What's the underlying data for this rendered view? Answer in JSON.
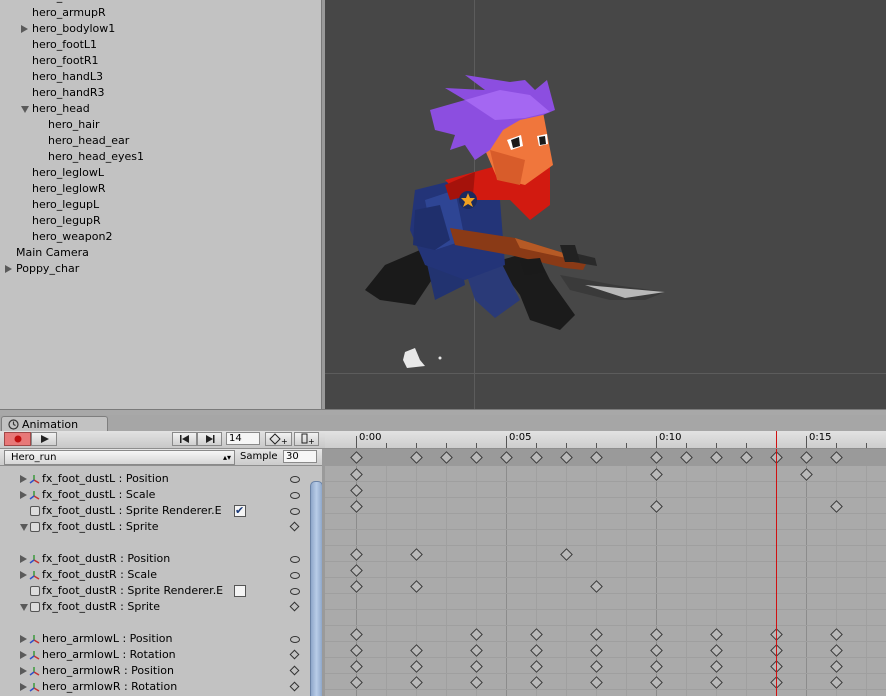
{
  "hierarchy": {
    "items": [
      {
        "label": "hero_armlowR",
        "indent": 32,
        "arrow": "",
        "partial": true
      },
      {
        "label": "hero_armupR",
        "indent": 32,
        "arrow": ""
      },
      {
        "label": "hero_bodylow1",
        "indent": 32,
        "arrow": "right"
      },
      {
        "label": "hero_footL1",
        "indent": 32,
        "arrow": ""
      },
      {
        "label": "hero_footR1",
        "indent": 32,
        "arrow": ""
      },
      {
        "label": "hero_handL3",
        "indent": 32,
        "arrow": ""
      },
      {
        "label": "hero_handR3",
        "indent": 32,
        "arrow": ""
      },
      {
        "label": "hero_head",
        "indent": 32,
        "arrow": "down"
      },
      {
        "label": "hero_hair",
        "indent": 48,
        "arrow": ""
      },
      {
        "label": "hero_head_ear",
        "indent": 48,
        "arrow": ""
      },
      {
        "label": "hero_head_eyes1",
        "indent": 48,
        "arrow": ""
      },
      {
        "label": "hero_leglowL",
        "indent": 32,
        "arrow": ""
      },
      {
        "label": "hero_leglowR",
        "indent": 32,
        "arrow": ""
      },
      {
        "label": "hero_legupL",
        "indent": 32,
        "arrow": ""
      },
      {
        "label": "hero_legupR",
        "indent": 32,
        "arrow": ""
      },
      {
        "label": "hero_weapon2",
        "indent": 32,
        "arrow": ""
      },
      {
        "label": "Main Camera",
        "indent": 16,
        "arrow": ""
      },
      {
        "label": "Poppy_char",
        "indent": 16,
        "arrow": "right"
      }
    ]
  },
  "animation": {
    "tab_label": "Animation",
    "frame_value": "14",
    "clip_name": "Hero_run",
    "sample_label": "Sample",
    "sample_value": "30",
    "time_labels": [
      "0:00",
      "0:05",
      "0:10",
      "0:15"
    ],
    "properties": [
      {
        "label": "fx_foot_dustL : Position",
        "icon": "transform",
        "arrow": "right",
        "state": "eye"
      },
      {
        "label": "fx_foot_dustL : Scale",
        "icon": "transform",
        "arrow": "right",
        "state": "eye"
      },
      {
        "label": "fx_foot_dustL : Sprite Renderer.E",
        "icon": "sprite",
        "arrow": "",
        "state": "eye",
        "checkbox": true
      },
      {
        "label": "fx_foot_dustL : Sprite",
        "icon": "sprite",
        "arrow": "down",
        "state": "diamond"
      },
      {
        "label": "",
        "icon": "",
        "arrow": "",
        "state": ""
      },
      {
        "label": "fx_foot_dustR : Position",
        "icon": "transform",
        "arrow": "right",
        "state": "eye"
      },
      {
        "label": "fx_foot_dustR : Scale",
        "icon": "transform",
        "arrow": "right",
        "state": "eye"
      },
      {
        "label": "fx_foot_dustR : Sprite Renderer.E",
        "icon": "sprite",
        "arrow": "",
        "state": "eye",
        "checkbox": false
      },
      {
        "label": "fx_foot_dustR : Sprite",
        "icon": "sprite",
        "arrow": "down",
        "state": "diamond"
      },
      {
        "label": "",
        "icon": "",
        "arrow": "",
        "state": ""
      },
      {
        "label": "hero_armlowL : Position",
        "icon": "transform",
        "arrow": "right",
        "state": "eye"
      },
      {
        "label": "hero_armlowL : Rotation",
        "icon": "transform",
        "arrow": "right",
        "state": "diamond"
      },
      {
        "label": "hero_armlowR : Position",
        "icon": "transform",
        "arrow": "right",
        "state": "diamond"
      },
      {
        "label": "hero_armlowR : Rotation",
        "icon": "transform",
        "arrow": "right",
        "state": "diamond",
        "partial": true
      }
    ],
    "keyframes": {
      "summary": [
        0,
        2,
        3,
        4,
        5,
        6,
        7,
        8,
        10,
        11,
        12,
        13,
        14,
        15,
        16
      ],
      "rows": [
        [
          0,
          10,
          15
        ],
        [
          0
        ],
        [
          0,
          10,
          16
        ],
        [],
        [],
        [
          0,
          2,
          7
        ],
        [
          0
        ],
        [
          0,
          2,
          8
        ],
        [],
        [],
        [
          0,
          4,
          6,
          8,
          10,
          12,
          14,
          16
        ],
        [
          0,
          2,
          4,
          6,
          8,
          10,
          12,
          14,
          16
        ],
        [
          0,
          2,
          4,
          6,
          8,
          10,
          12,
          14,
          16
        ],
        [
          0,
          2,
          4,
          6,
          8,
          10,
          12,
          14,
          16
        ]
      ]
    },
    "current_frame_index": 14
  },
  "colors": {
    "record_active": "#e87878",
    "playhead": "#d01010",
    "scene_bg": "#474747",
    "scrollbar": "#9db3d6"
  }
}
